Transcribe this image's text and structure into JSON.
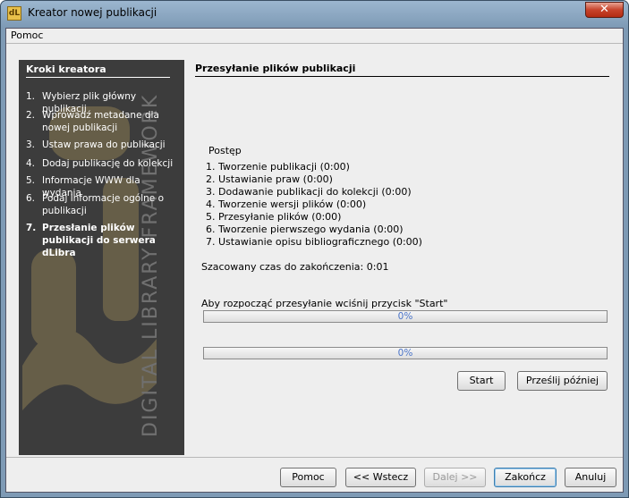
{
  "window": {
    "title": "Kreator nowej publikacji",
    "icon_label": "dL",
    "close_glyph": "✕"
  },
  "menu": {
    "help": "Pomoc"
  },
  "steps": {
    "title": "Kroki kreatora",
    "items": [
      {
        "num": "1.",
        "label": "Wybierz plik główny publikacji"
      },
      {
        "num": "2.",
        "label": "Wprowadź metadane dla nowej publikacji"
      },
      {
        "num": "3.",
        "label": "Ustaw prawa do publikacji"
      },
      {
        "num": "4.",
        "label": "Dodaj publikację do kolekcji"
      },
      {
        "num": "5.",
        "label": "Informacje WWW dla wydania"
      },
      {
        "num": "6.",
        "label": "Podaj informacje ogólne o publikacji"
      },
      {
        "num": "7.",
        "label": "Przesłanie plików publikacji do serwera dLibra"
      }
    ],
    "active_index": 6
  },
  "content": {
    "title": "Przesyłanie plików publikacji",
    "progress_heading": "Postęp",
    "progress_items": [
      "1. Tworzenie publikacji (0:00)",
      "2. Ustawianie praw (0:00)",
      "3. Dodawanie publikacji do kolekcji (0:00)",
      "4. Tworzenie wersji plików (0:00)",
      "5. Przesyłanie plików (0:00)",
      "6. Tworzenie pierwszego wydania (0:00)",
      "7. Ustawianie opisu bibliograficznego (0:00)"
    ],
    "estimated_time": "Szacowany czas do zakończenia: 0:01",
    "start_hint": "Aby rozpocząć przesyłanie wciśnij przycisk \"Start\"",
    "progress1": {
      "label": "0%",
      "value": 0.0
    },
    "progress2": {
      "label": "0%",
      "value": 0.0
    },
    "start_button": "Start",
    "later_button": "Prześlij później"
  },
  "footer": {
    "help": "Pomoc",
    "back": "<< Wstecz",
    "next": "Dalej >>",
    "finish": "Zakończ",
    "cancel": "Anuluj"
  },
  "watermark_text": "DIGITAL LIBRARY FRAMEWORK"
}
